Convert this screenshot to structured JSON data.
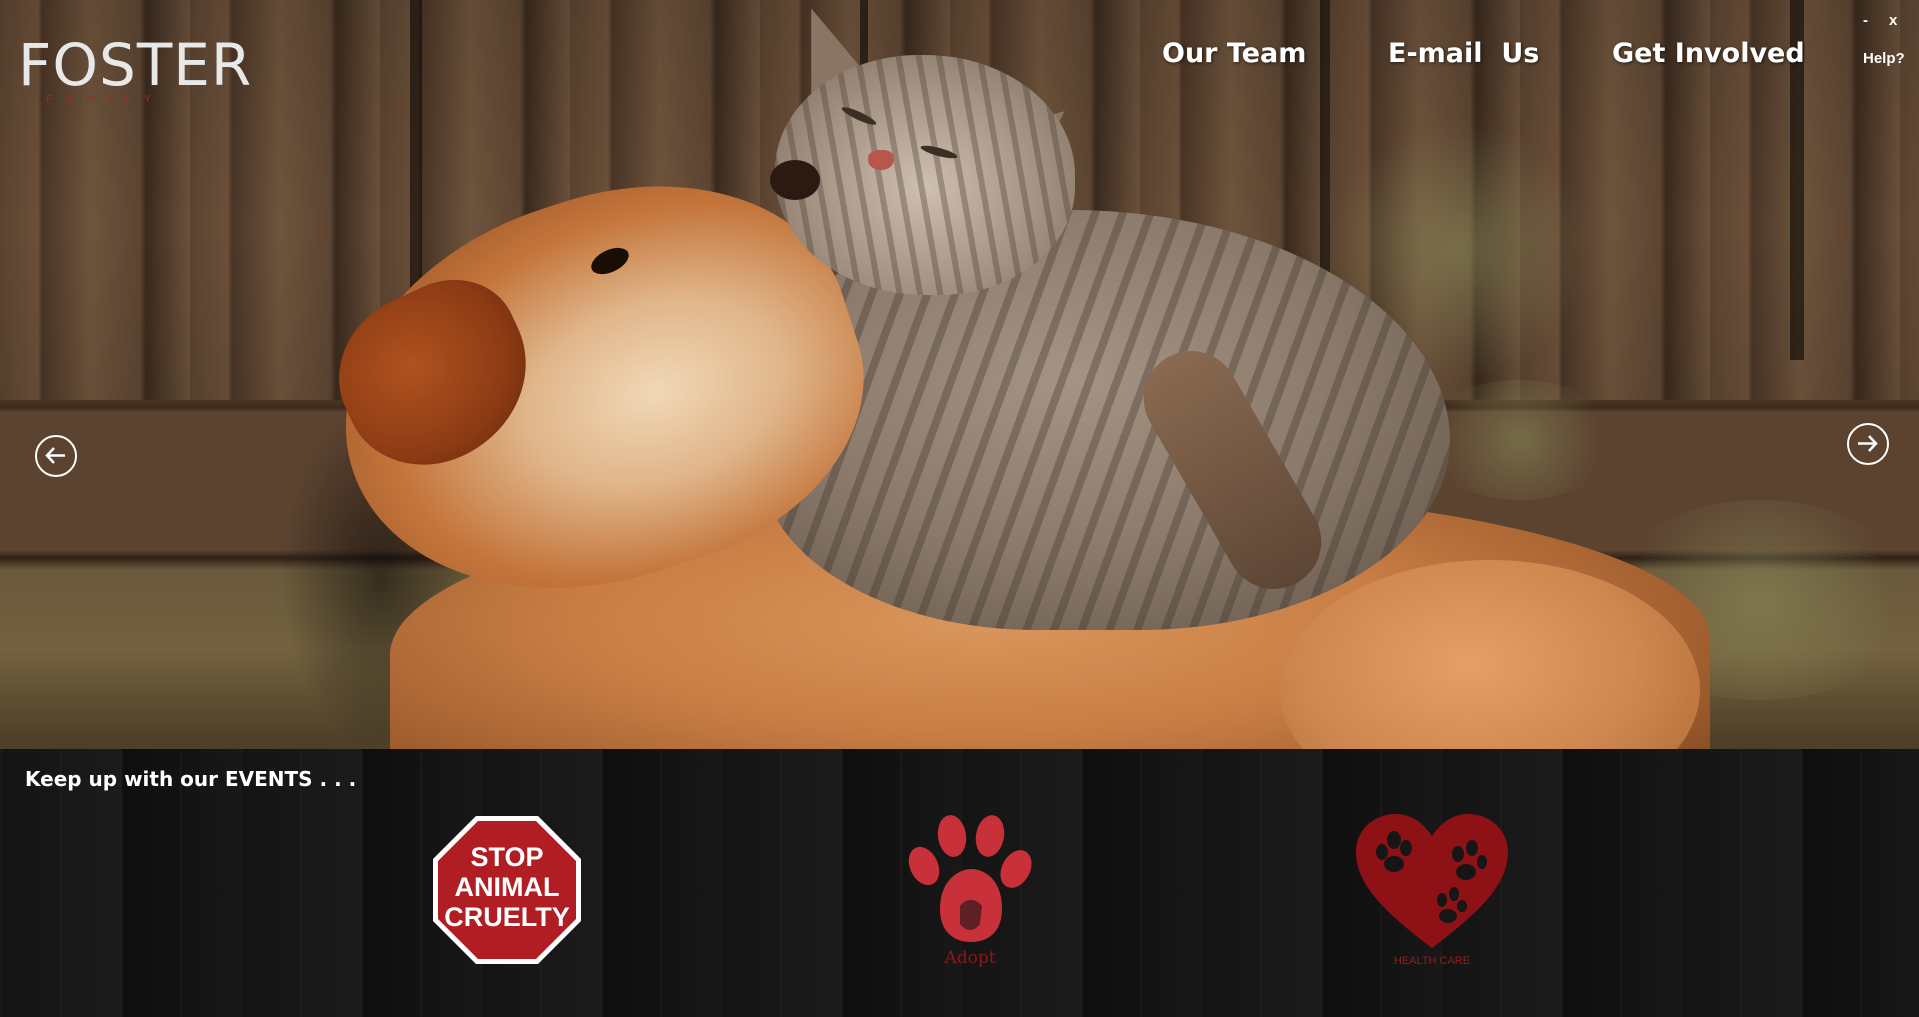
{
  "app": {
    "logo_text": "FOSTER",
    "logo_subtext": "FAMILY"
  },
  "window_controls": {
    "minimize": "-",
    "close": "x"
  },
  "nav": {
    "items": [
      {
        "label": "Our Team"
      },
      {
        "label": "E-mail  Us"
      },
      {
        "label": "Get Involved"
      }
    ],
    "help_label": "Help?"
  },
  "hero": {
    "prev_icon": "arrow-left-circle-icon",
    "next_icon": "arrow-right-circle-icon"
  },
  "events": {
    "title": "Keep up with our EVENTS . . .",
    "tiles": [
      {
        "icon": "stop-sign-icon",
        "sign_lines": [
          "STOP",
          "ANIMAL",
          "CRUELTY"
        ]
      },
      {
        "icon": "paw-print-icon",
        "label": "Adopt"
      },
      {
        "icon": "heart-paws-icon",
        "label": "HEALTH CARE"
      }
    ]
  },
  "colors": {
    "accent_red": "#b01e23",
    "dark_red": "#8e1116",
    "nav_text": "#ffffff",
    "events_bg": "#161616"
  }
}
